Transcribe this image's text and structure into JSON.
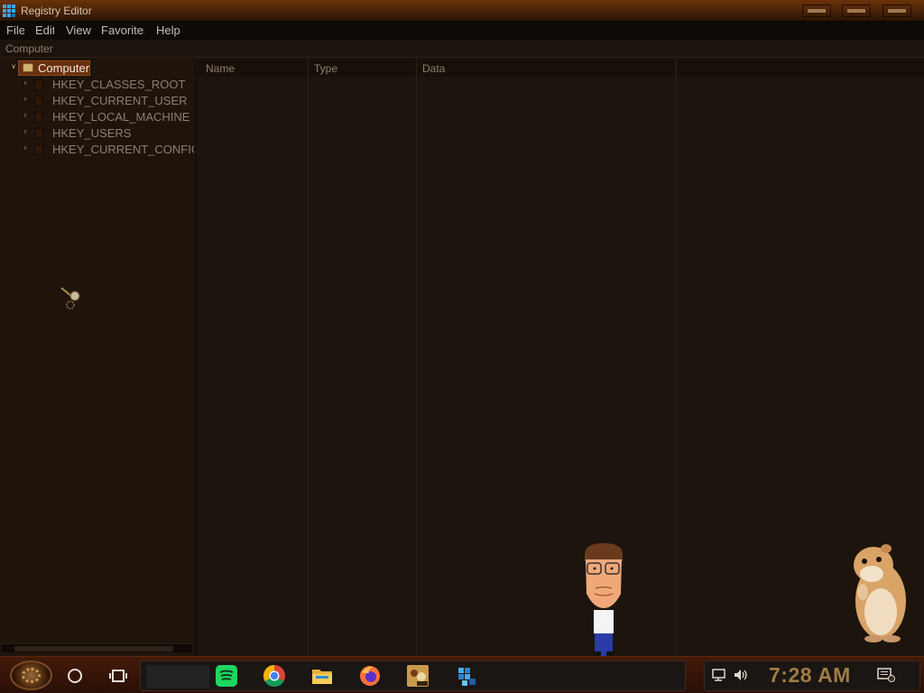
{
  "window": {
    "title": "Registry Editor",
    "app_icon": "registry-editor-icon"
  },
  "menu": {
    "items": [
      {
        "label": "File"
      },
      {
        "label": "Edit"
      },
      {
        "label": "View"
      },
      {
        "label": "Favorites"
      },
      {
        "label": "Help"
      }
    ]
  },
  "address": {
    "path": "Computer"
  },
  "tree": {
    "root": {
      "label": "Computer",
      "icon": "computer-icon",
      "selected": true,
      "expanded": true
    },
    "children": [
      {
        "label": "HKEY_CLASSES_ROOT"
      },
      {
        "label": "HKEY_CURRENT_USER"
      },
      {
        "label": "HKEY_LOCAL_MACHINE"
      },
      {
        "label": "HKEY_USERS"
      },
      {
        "label": "HKEY_CURRENT_CONFIG"
      }
    ]
  },
  "list": {
    "columns": [
      {
        "label": "Name"
      },
      {
        "label": "Type"
      },
      {
        "label": "Data"
      }
    ],
    "rows": []
  },
  "taskbar": {
    "start_icon": "steampunk-gear-icon",
    "search_icon": "cortana-circle-icon",
    "task_view_icon": "task-view-icon",
    "pinned_apps": [
      {
        "name": "spotify-icon"
      },
      {
        "name": "chrome-icon"
      },
      {
        "name": "file-explorer-icon"
      },
      {
        "name": "firefox-icon"
      },
      {
        "name": "game-icon"
      },
      {
        "name": "registry-editor-icon"
      }
    ],
    "tray": {
      "icons": [
        "network-icon",
        "volume-icon",
        "notifications-icon"
      ],
      "time": "7:28 AM"
    }
  },
  "colors": {
    "titlebar": "#4a2208",
    "pane_bg": "#1c140d",
    "text": "#8e7e6c",
    "selection": "#6a3010",
    "clock": "#a07c44"
  }
}
